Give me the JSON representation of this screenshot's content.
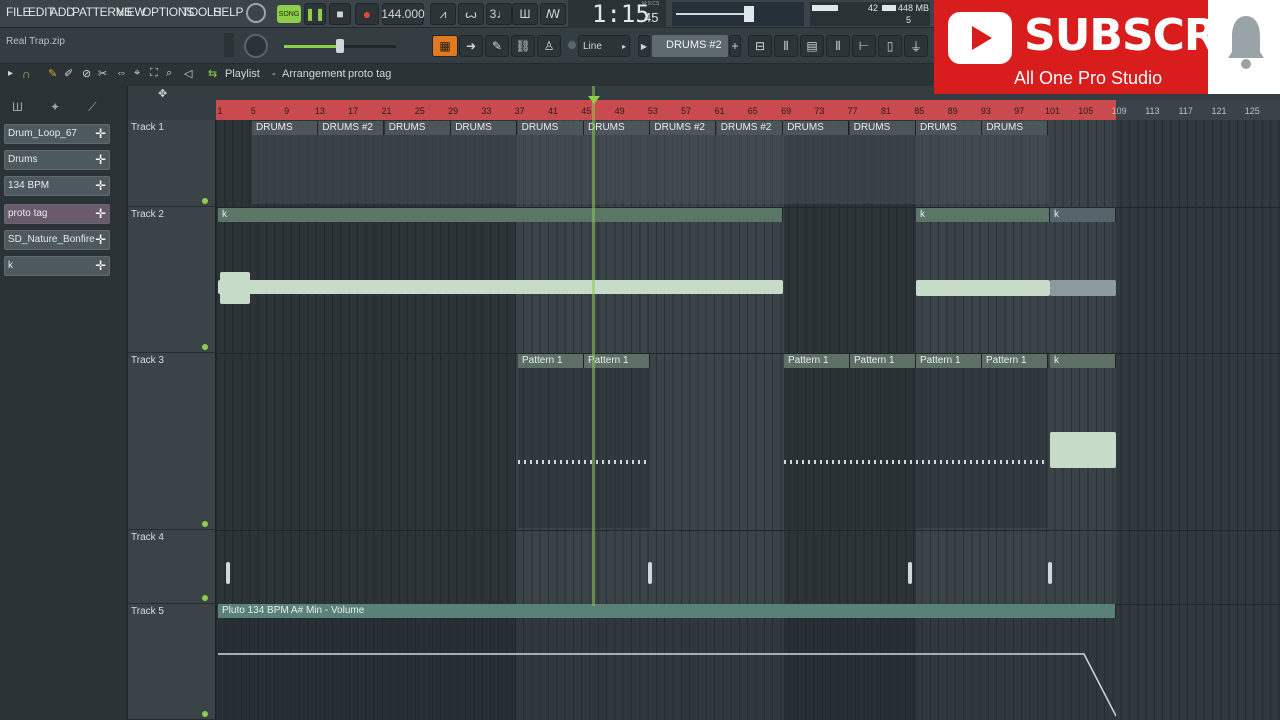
{
  "menu": [
    "FILE",
    "EDIT",
    "ADD",
    "PATTERNS",
    "VIEW",
    "OPTIONS",
    "TOOLS",
    "HELP"
  ],
  "transport": {
    "song_label": "SONG",
    "tempo": "144.000",
    "time": "1:15",
    "time_small": "45",
    "time_unit": "M:S:CS"
  },
  "monitor": {
    "cpu": "42",
    "mem": "448 MB",
    "voices": "5"
  },
  "hint_text": "Real Trap.zip",
  "snap": "Line",
  "pattern_selector": "DRUMS #2",
  "breadcrumb": {
    "part1": "Playlist",
    "sep1": "-",
    "part2": "Arrangement",
    "sep2": "›",
    "part3": "proto tag"
  },
  "channels": [
    "Drum_Loop_67",
    "Drums",
    "134 BPM",
    "proto tag",
    "SD_Nature_Bonfire",
    "k"
  ],
  "ruler_labels": [
    "1",
    "5",
    "9",
    "13",
    "17",
    "21",
    "25",
    "29",
    "33",
    "37",
    "41",
    "45",
    "49",
    "53",
    "57",
    "61",
    "65",
    "69",
    "73",
    "77",
    "81",
    "85",
    "89",
    "93",
    "97",
    "101",
    "105",
    "109",
    "113",
    "117",
    "121",
    "125"
  ],
  "tracks": [
    "Track 1",
    "Track 2",
    "Track 3",
    "Track 4",
    "Track 5"
  ],
  "track1_clips": [
    "DRUMS",
    "DRUMS #2",
    "DRUMS",
    "DRUMS",
    "DRUMS",
    "DRUMS",
    "DRUMS #2",
    "DRUMS #2",
    "DRUMS",
    "DRUMS",
    "DRUMS",
    "DRUMS"
  ],
  "track2_clip": "k",
  "track3_clips": [
    "Pattern 1",
    "Pattern 1",
    "Pattern 1",
    "Pattern 1",
    "Pattern 1",
    "Pattern 1",
    "k"
  ],
  "track5_clip": "Pluto 134 BPM A# Min - Volume",
  "youtube": {
    "subscribe": "SUBSCRIBE",
    "channel": "All One Pro Studio"
  },
  "colors": {
    "ruler": "#c94a4f",
    "accent_green": "#8fce4a",
    "youtube_red": "#d91c1c"
  }
}
